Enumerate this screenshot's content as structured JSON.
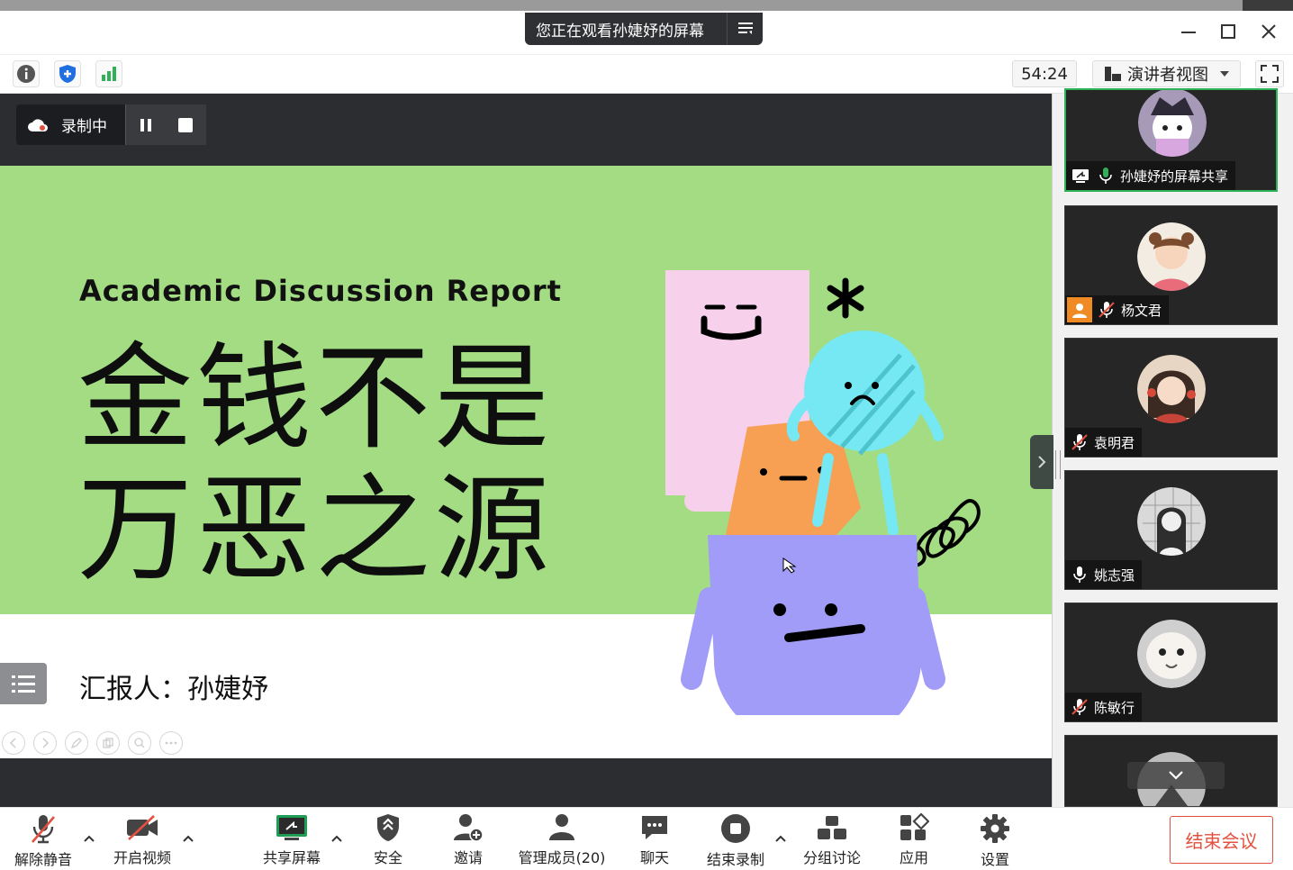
{
  "window": {
    "viewing_banner": "您正在观看孙婕妤的屏幕"
  },
  "toolbar": {
    "timer": "54:24",
    "view_mode": "演讲者视图"
  },
  "recording": {
    "status": "录制中"
  },
  "slide": {
    "subtitle": "Academic Discussion Report",
    "title_line1": "金钱不是",
    "title_line2": "万恶之源",
    "reporter": "汇报人：孙婕妤"
  },
  "participants": [
    {
      "name": "孙婕妤的屏幕共享",
      "mic": "on",
      "sharing": true
    },
    {
      "name": "杨文君",
      "mic": "muted",
      "no_video": true
    },
    {
      "name": "袁明君",
      "mic": "muted"
    },
    {
      "name": "姚志强",
      "mic": "on"
    },
    {
      "name": "陈敏行",
      "mic": "muted"
    }
  ],
  "bottom": {
    "unmute": "解除静音",
    "start_video": "开启视频",
    "share_screen": "共享屏幕",
    "security": "安全",
    "invite": "邀请",
    "manage_members": "管理成员(20)",
    "chat": "聊天",
    "stop_recording": "结束录制",
    "breakout": "分组讨论",
    "apps": "应用",
    "settings": "设置",
    "end_meeting": "结束会议"
  },
  "colors": {
    "slide_green": "#a3dc82",
    "active_tile_border": "#2fb157",
    "end_meeting": "#e2513f"
  }
}
